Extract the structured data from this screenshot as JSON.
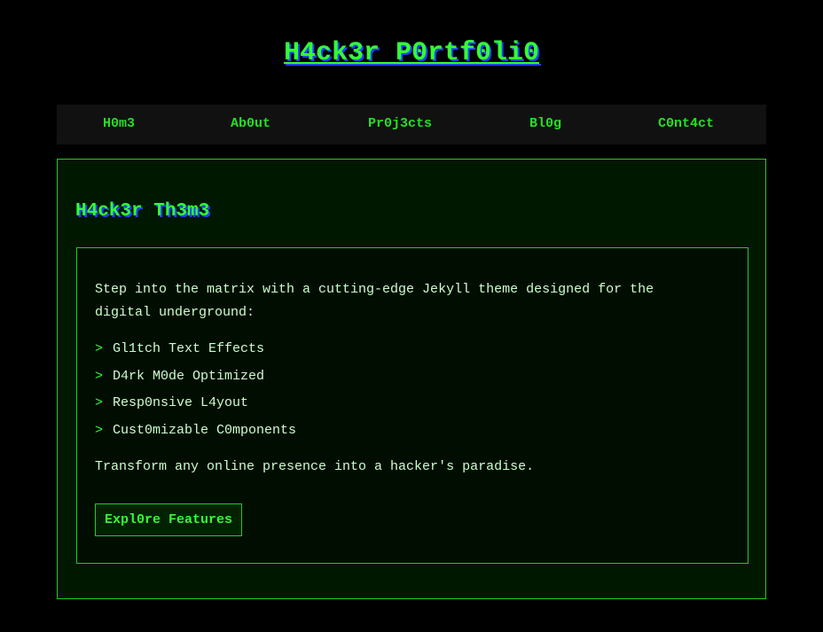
{
  "site": {
    "title": "H4ck3r P0rtf0li0"
  },
  "nav": {
    "items": [
      {
        "label": "H0m3"
      },
      {
        "label": "Ab0ut"
      },
      {
        "label": "Pr0j3cts"
      },
      {
        "label": "Bl0g"
      },
      {
        "label": "C0nt4ct"
      }
    ]
  },
  "hero": {
    "title": "H4ck3r Th3m3",
    "intro": "Step into the matrix with a cutting-edge Jekyll theme designed for the digital underground:",
    "bullet": ">",
    "features": [
      {
        "label": "Gl1tch Text Effects"
      },
      {
        "label": "D4rk M0de Optimized"
      },
      {
        "label": "Resp0nsive L4yout"
      },
      {
        "label": "Cust0mizable C0mponents"
      }
    ],
    "outro": "Transform any online presence into a hacker's paradise.",
    "cta_label": "Expl0re Features"
  },
  "colors": {
    "background": "#000000",
    "accent": "#33ff33",
    "glitch_shadow": "#2244ff",
    "panel": "#001800",
    "nav_bar": "#111111"
  }
}
